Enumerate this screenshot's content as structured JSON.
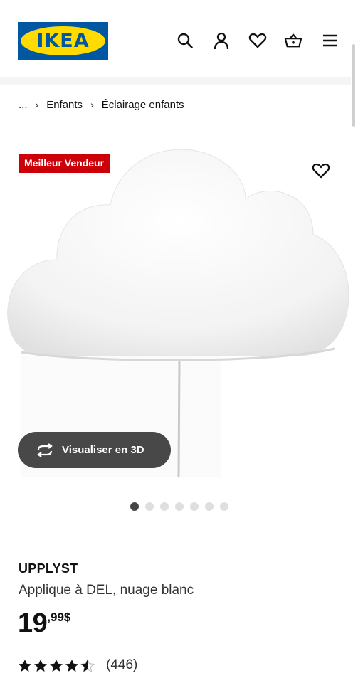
{
  "header": {
    "logo_text": "IKEA",
    "icons": [
      "search-icon",
      "account-icon",
      "heart-icon",
      "cart-icon",
      "menu-icon"
    ]
  },
  "breadcrumb": {
    "ellipsis": "...",
    "items": [
      "Enfants",
      "Éclairage enfants"
    ]
  },
  "badge": {
    "label": "Meilleur Vendeur",
    "color": "#cc0008"
  },
  "gallery": {
    "button_3d_label": "Visualiser en 3D",
    "slide_count": 7,
    "active_slide": 1
  },
  "product": {
    "name": "UPPLYST",
    "description": "Applique à DEL, nuage blanc",
    "price_integer": "19",
    "price_decimal": ",99$",
    "rating": 4.5,
    "rating_max": 5,
    "reviews": "(446)"
  },
  "colors": {
    "brand_blue": "#0058a3",
    "brand_yellow": "#ffdb00",
    "badge_red": "#cc0008",
    "button_dark": "#484848"
  }
}
